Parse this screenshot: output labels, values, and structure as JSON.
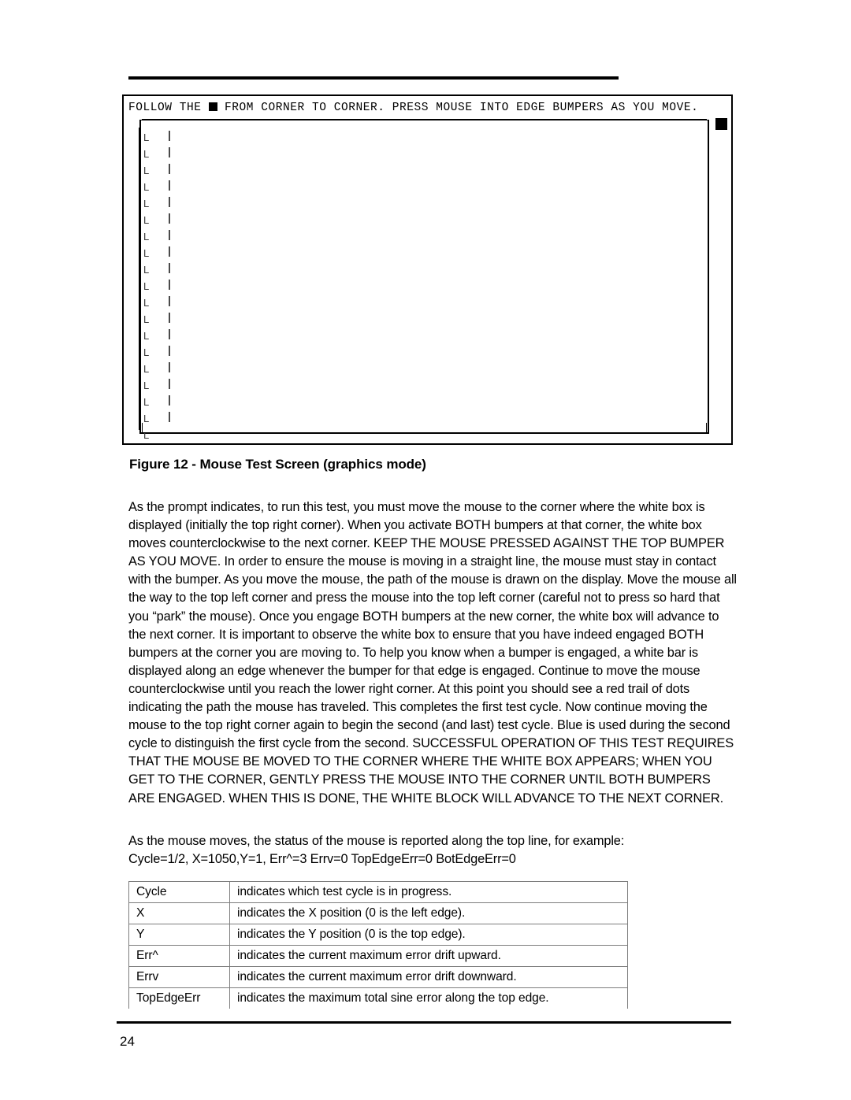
{
  "figure": {
    "prompt_prefix": "FOLLOW THE ",
    "prompt_marker_icon": "filled-square",
    "prompt_suffix": " FROM CORNER TO CORNER. PRESS MOUSE INTO EDGE BUMPERS AS YOU MOVE.",
    "white_box_marker_icon": "white-box-cursor",
    "path_glyph": "L",
    "path_glyph_count": 19,
    "caption": "Figure 12 - Mouse Test Screen (graphics mode)"
  },
  "body": {
    "paragraph_main": "As the prompt indicates, to run this test, you must move the mouse to the corner where the white box is displayed (initially the top right corner).  When you activate BOTH bumpers at that corner, the white box moves counterclockwise to the next corner.  KEEP THE MOUSE PRESSED AGAINST THE TOP BUMPER AS YOU MOVE.  In order to ensure the mouse is moving in a straight line, the mouse must stay in contact with the bumper.  As you move the mouse, the path of the mouse is drawn on the display.  Move the mouse all the way to the top left corner and press the mouse into the top left corner (careful not to press so hard that you “park” the mouse).  Once you engage BOTH bumpers at the new corner, the white box will advance to the next corner.  It is important to observe the white box to ensure that you have indeed engaged BOTH bumpers at the corner you are moving to.  To help you know when a bumper is engaged, a white bar is displayed along an edge whenever the bumper for that edge is engaged.  Continue to move the mouse counterclockwise until you reach the lower right corner.  At this point you should see a red trail of dots indicating the path the mouse has traveled.  This completes the first test cycle.  Now continue moving the mouse to the top right corner again to begin the second (and last) test cycle.  Blue is used during the second cycle to distinguish the first cycle from the second.  SUCCESSFUL OPERATION OF THIS TEST REQUIRES THAT THE MOUSE BE MOVED TO THE CORNER WHERE THE WHITE BOX APPEARS; WHEN YOU GET TO THE CORNER, GENTLY PRESS THE MOUSE INTO THE CORNER UNTIL BOTH BUMPERS ARE ENGAGED.  WHEN THIS IS DONE, THE WHITE BLOCK WILL ADVANCE TO THE NEXT CORNER.",
    "paragraph_status_intro": "As the mouse moves, the status of the mouse is reported along the top line, for example:",
    "status_example": "Cycle=1/2, X=1050,Y=1, Err^=3 Errv=0  TopEdgeErr=0 BotEdgeErr=0"
  },
  "definition_table": {
    "rows": [
      {
        "term": "Cycle",
        "description": "indicates which test cycle is in progress."
      },
      {
        "term": "X",
        "description": "indicates the X position (0 is the left edge)."
      },
      {
        "term": "Y",
        "description": "indicates the Y position (0 is the top edge)."
      },
      {
        "term": "Err^",
        "description": "indicates the current maximum error drift upward."
      },
      {
        "term": "Errv",
        "description": "indicates the current maximum error drift downward."
      },
      {
        "term": "TopEdgeErr",
        "description": "indicates the maximum total sine error along the top edge."
      }
    ]
  },
  "footer": {
    "page_number": "24"
  }
}
